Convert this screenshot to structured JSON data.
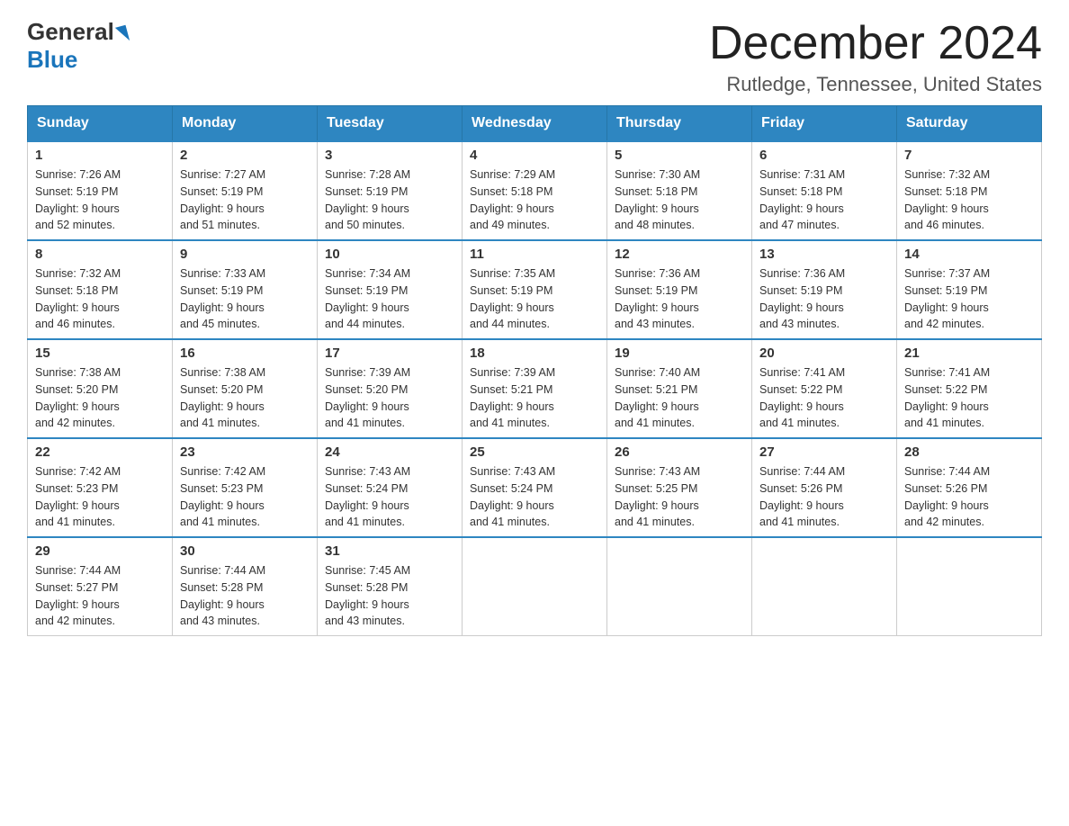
{
  "header": {
    "logo_general": "General",
    "logo_blue": "Blue",
    "month_title": "December 2024",
    "location": "Rutledge, Tennessee, United States"
  },
  "days_of_week": [
    "Sunday",
    "Monday",
    "Tuesday",
    "Wednesday",
    "Thursday",
    "Friday",
    "Saturday"
  ],
  "weeks": [
    [
      {
        "day": "1",
        "sunrise": "7:26 AM",
        "sunset": "5:19 PM",
        "daylight": "9 hours and 52 minutes."
      },
      {
        "day": "2",
        "sunrise": "7:27 AM",
        "sunset": "5:19 PM",
        "daylight": "9 hours and 51 minutes."
      },
      {
        "day": "3",
        "sunrise": "7:28 AM",
        "sunset": "5:19 PM",
        "daylight": "9 hours and 50 minutes."
      },
      {
        "day": "4",
        "sunrise": "7:29 AM",
        "sunset": "5:18 PM",
        "daylight": "9 hours and 49 minutes."
      },
      {
        "day": "5",
        "sunrise": "7:30 AM",
        "sunset": "5:18 PM",
        "daylight": "9 hours and 48 minutes."
      },
      {
        "day": "6",
        "sunrise": "7:31 AM",
        "sunset": "5:18 PM",
        "daylight": "9 hours and 47 minutes."
      },
      {
        "day": "7",
        "sunrise": "7:32 AM",
        "sunset": "5:18 PM",
        "daylight": "9 hours and 46 minutes."
      }
    ],
    [
      {
        "day": "8",
        "sunrise": "7:32 AM",
        "sunset": "5:18 PM",
        "daylight": "9 hours and 46 minutes."
      },
      {
        "day": "9",
        "sunrise": "7:33 AM",
        "sunset": "5:19 PM",
        "daylight": "9 hours and 45 minutes."
      },
      {
        "day": "10",
        "sunrise": "7:34 AM",
        "sunset": "5:19 PM",
        "daylight": "9 hours and 44 minutes."
      },
      {
        "day": "11",
        "sunrise": "7:35 AM",
        "sunset": "5:19 PM",
        "daylight": "9 hours and 44 minutes."
      },
      {
        "day": "12",
        "sunrise": "7:36 AM",
        "sunset": "5:19 PM",
        "daylight": "9 hours and 43 minutes."
      },
      {
        "day": "13",
        "sunrise": "7:36 AM",
        "sunset": "5:19 PM",
        "daylight": "9 hours and 43 minutes."
      },
      {
        "day": "14",
        "sunrise": "7:37 AM",
        "sunset": "5:19 PM",
        "daylight": "9 hours and 42 minutes."
      }
    ],
    [
      {
        "day": "15",
        "sunrise": "7:38 AM",
        "sunset": "5:20 PM",
        "daylight": "9 hours and 42 minutes."
      },
      {
        "day": "16",
        "sunrise": "7:38 AM",
        "sunset": "5:20 PM",
        "daylight": "9 hours and 41 minutes."
      },
      {
        "day": "17",
        "sunrise": "7:39 AM",
        "sunset": "5:20 PM",
        "daylight": "9 hours and 41 minutes."
      },
      {
        "day": "18",
        "sunrise": "7:39 AM",
        "sunset": "5:21 PM",
        "daylight": "9 hours and 41 minutes."
      },
      {
        "day": "19",
        "sunrise": "7:40 AM",
        "sunset": "5:21 PM",
        "daylight": "9 hours and 41 minutes."
      },
      {
        "day": "20",
        "sunrise": "7:41 AM",
        "sunset": "5:22 PM",
        "daylight": "9 hours and 41 minutes."
      },
      {
        "day": "21",
        "sunrise": "7:41 AM",
        "sunset": "5:22 PM",
        "daylight": "9 hours and 41 minutes."
      }
    ],
    [
      {
        "day": "22",
        "sunrise": "7:42 AM",
        "sunset": "5:23 PM",
        "daylight": "9 hours and 41 minutes."
      },
      {
        "day": "23",
        "sunrise": "7:42 AM",
        "sunset": "5:23 PM",
        "daylight": "9 hours and 41 minutes."
      },
      {
        "day": "24",
        "sunrise": "7:43 AM",
        "sunset": "5:24 PM",
        "daylight": "9 hours and 41 minutes."
      },
      {
        "day": "25",
        "sunrise": "7:43 AM",
        "sunset": "5:24 PM",
        "daylight": "9 hours and 41 minutes."
      },
      {
        "day": "26",
        "sunrise": "7:43 AM",
        "sunset": "5:25 PM",
        "daylight": "9 hours and 41 minutes."
      },
      {
        "day": "27",
        "sunrise": "7:44 AM",
        "sunset": "5:26 PM",
        "daylight": "9 hours and 41 minutes."
      },
      {
        "day": "28",
        "sunrise": "7:44 AM",
        "sunset": "5:26 PM",
        "daylight": "9 hours and 42 minutes."
      }
    ],
    [
      {
        "day": "29",
        "sunrise": "7:44 AM",
        "sunset": "5:27 PM",
        "daylight": "9 hours and 42 minutes."
      },
      {
        "day": "30",
        "sunrise": "7:44 AM",
        "sunset": "5:28 PM",
        "daylight": "9 hours and 43 minutes."
      },
      {
        "day": "31",
        "sunrise": "7:45 AM",
        "sunset": "5:28 PM",
        "daylight": "9 hours and 43 minutes."
      },
      null,
      null,
      null,
      null
    ]
  ],
  "labels": {
    "sunrise_prefix": "Sunrise: ",
    "sunset_prefix": "Sunset: ",
    "daylight_prefix": "Daylight: "
  }
}
